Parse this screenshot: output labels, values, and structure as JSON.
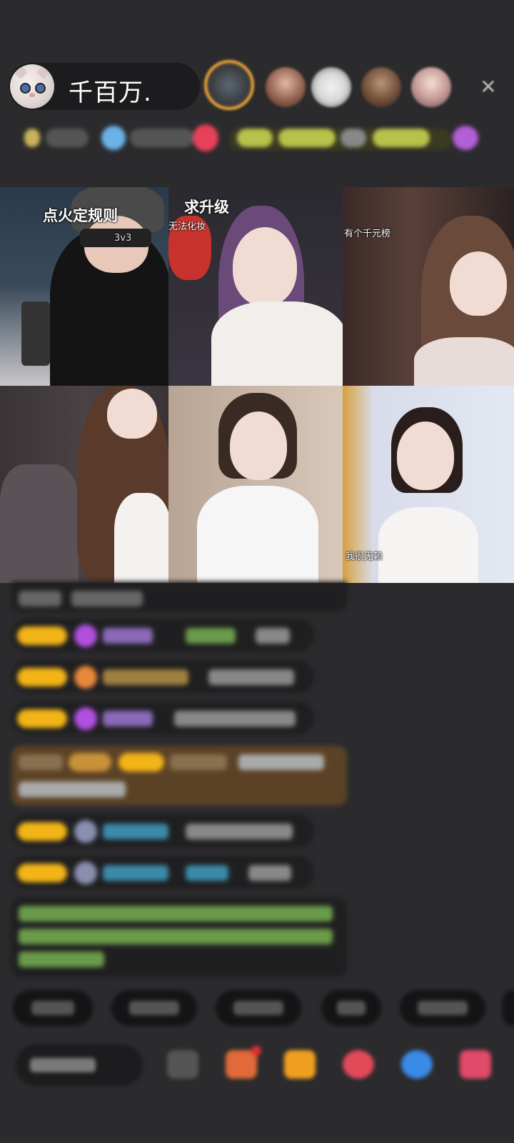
{
  "header": {
    "host_name": "千百万.",
    "close_icon": "close-icon",
    "viewer_count": 5
  },
  "grid": {
    "tiles": [
      {
        "overlay": "点火定规则",
        "tag": "3v3"
      },
      {
        "overlay": "求升级",
        "caption": "无法化妆"
      },
      {
        "caption": "有个千元榜"
      },
      {},
      {},
      {
        "caption": "我很无赖"
      }
    ]
  },
  "colors": {
    "background": "#2b2b2d",
    "badge": "#f3b418",
    "highlight_box": "#5b4226",
    "accent_orange": "#f0a63a"
  },
  "icons": [
    "gift-icon",
    "shop-icon",
    "chat-icon",
    "share-icon",
    "more-icon"
  ]
}
